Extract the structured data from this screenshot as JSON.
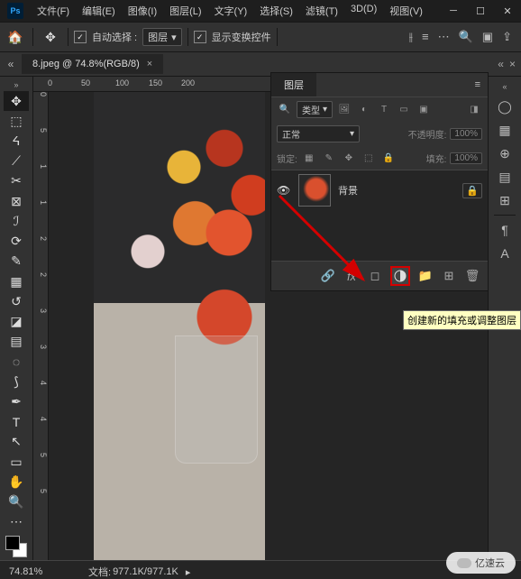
{
  "menu": {
    "file": "文件(F)",
    "edit": "编辑(E)",
    "image": "图像(I)",
    "layer": "图层(L)",
    "type": "文字(Y)",
    "select": "选择(S)",
    "filter": "滤镜(T)",
    "threeD": "3D(D)",
    "view": "视图(V)"
  },
  "options_bar": {
    "auto_select": "自动选择 :",
    "target": "图层",
    "show_transform": "显示变换控件"
  },
  "tab": {
    "title": "8.jpeg @ 74.8%(RGB/8)"
  },
  "ruler_h": [
    "0",
    "50",
    "100",
    "150",
    "200"
  ],
  "ruler_v": [
    "0",
    "0",
    "5",
    "1",
    "1",
    "2",
    "2",
    "3",
    "3",
    "4",
    "4",
    "5",
    "5"
  ],
  "layers_panel": {
    "tab": "图层",
    "kind_label": "类型",
    "blend": "正常",
    "opacity_label": "不透明度:",
    "opacity_value": "100%",
    "lock_label": "锁定:",
    "fill_label": "填充:",
    "fill_value": "100%",
    "layer_name": "背景"
  },
  "tooltip": "创建新的填充或调整图层",
  "status": {
    "zoom": "74.81%",
    "doc_label": "文档:",
    "doc_value": "977.1K/977.1K"
  },
  "watermark": "亿速云"
}
